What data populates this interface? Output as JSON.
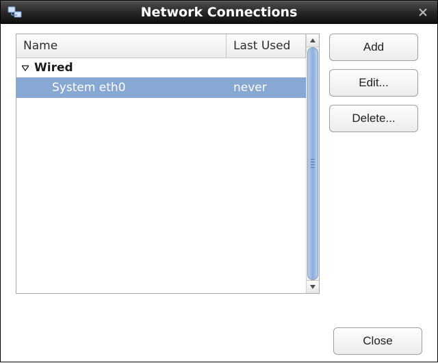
{
  "window": {
    "title": "Network Connections"
  },
  "columns": {
    "name": "Name",
    "last_used": "Last Used"
  },
  "groups": [
    {
      "label": "Wired",
      "expanded": true,
      "items": [
        {
          "name": "System eth0",
          "last_used": "never",
          "selected": true
        }
      ]
    }
  ],
  "buttons": {
    "add": "Add",
    "edit": "Edit...",
    "delete": "Delete...",
    "close": "Close"
  },
  "icons": {
    "app": "network-connections-icon",
    "close": "close-icon",
    "disclosure_open": "triangle-down-icon"
  }
}
